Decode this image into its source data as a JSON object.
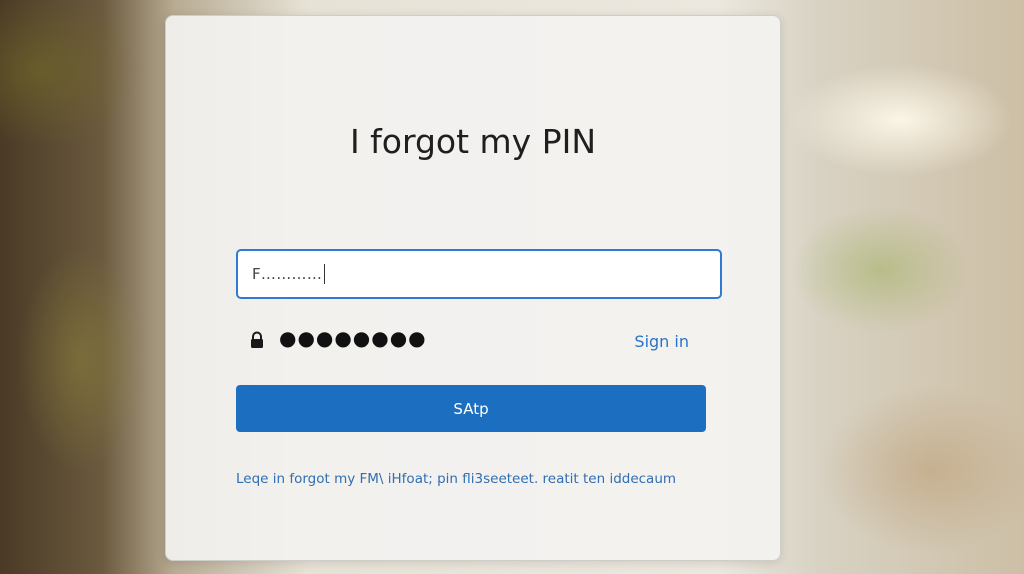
{
  "dialog": {
    "title": "I forgot my PIN",
    "account_field": {
      "value": "F…………"
    },
    "pin_row": {
      "masked_pin": "●●●●●●●●",
      "sign_in_label": "Sign in",
      "icon": "lock-icon"
    },
    "primary_button_label": "SAtp",
    "footer_link": "Leqe in forgot my FM\\ iHfoat; pin fli3seeteet. reatit ten iddecaum"
  },
  "colors": {
    "accent": "#1c6fc0",
    "link": "#2a74c4",
    "input_border": "#2f7bd1"
  }
}
